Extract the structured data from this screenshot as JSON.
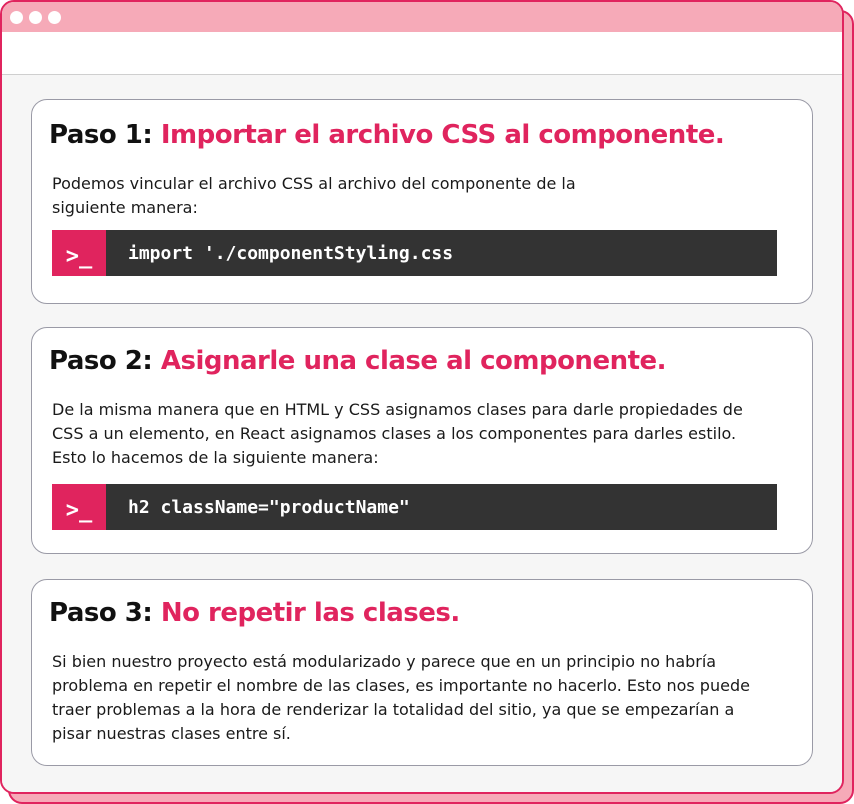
{
  "window": {
    "controls": [
      "window-dot",
      "window-dot",
      "window-dot"
    ]
  },
  "steps": [
    {
      "label": "Paso 1:",
      "title": "Importar el archivo CSS al componente.",
      "body": "Podemos vincular el archivo CSS al archivo del componente de la siguiente manera:",
      "prompt": ">_",
      "code": "import './componentStyling.css"
    },
    {
      "label": "Paso 2:",
      "title": "Asignarle una clase al componente.",
      "body": "De la misma manera que en HTML y CSS asignamos clases para darle propiedades de CSS a un elemento, en React asignamos clases a los componentes para darles estilo. Esto lo hacemos de la siguiente manera:",
      "prompt": ">_",
      "code": "h2 className=\"productName\""
    },
    {
      "label": "Paso 3:",
      "title": "No repetir las clases.",
      "body": "Si bien nuestro proyecto está modularizado y parece que en un principio no habría problema en repetir el nombre de las clases, es importante no hacerlo. Esto nos puede traer problemas a la hora de renderizar la totalidad del sitio, ya que se empezarían a pisar nuestras clases entre sí."
    }
  ],
  "colors": {
    "accent": "#e0245e",
    "titlebar": "#f6aab8",
    "code_bg": "#333333"
  }
}
